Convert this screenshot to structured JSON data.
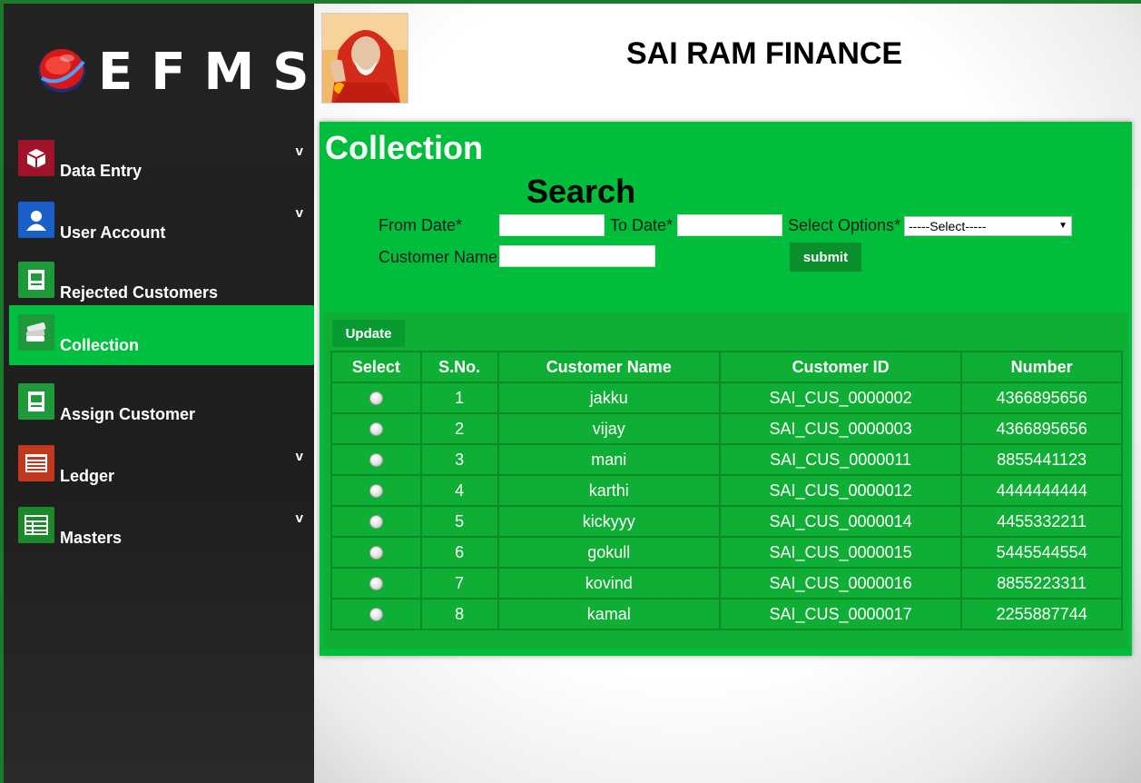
{
  "brand": {
    "logo_text": "EFMS",
    "app_title": "SAI RAM FINANCE"
  },
  "sidebar": {
    "items": [
      {
        "label": "Data Entry",
        "icon": "box-icon",
        "icon_color": "#a0142a",
        "chevron": "v",
        "active": false
      },
      {
        "label": "User Account",
        "icon": "user-icon",
        "icon_color": "#1a5fc8",
        "chevron": "v",
        "active": false
      },
      {
        "label": "Rejected Customers",
        "icon": "document-icon",
        "icon_color": "#1e9a3a",
        "chevron": "",
        "active": false
      },
      {
        "label": "Collection",
        "icon": "money-icon",
        "icon_color": "#1e9a3a",
        "chevron": "",
        "active": true
      },
      {
        "label": "Assign Customer",
        "icon": "document-icon",
        "icon_color": "#1e9a3a",
        "chevron": "",
        "active": false
      },
      {
        "label": "Ledger",
        "icon": "ledger-icon",
        "icon_color": "#c0391e",
        "chevron": "v",
        "active": false
      },
      {
        "label": "Masters",
        "icon": "table-icon",
        "icon_color": "#1a8a2a",
        "chevron": "v",
        "active": false
      }
    ]
  },
  "main": {
    "section_title": "Collection",
    "search": {
      "title": "Search",
      "from_date_label": "From Date*",
      "from_date_value": "",
      "to_date_label": "To Date*",
      "to_date_value": "",
      "select_options_label": "Select Options*",
      "select_options_value": "-----Select-----",
      "customer_name_label": "Customer Name",
      "customer_name_value": "",
      "submit_label": "submit"
    },
    "update_label": "Update",
    "table": {
      "headers": [
        "Select",
        "S.No.",
        "Customer Name",
        "Customer ID",
        "Number"
      ],
      "rows": [
        {
          "sno": "1",
          "name": "jakku",
          "id": "SAI_CUS_0000002",
          "number": "4366895656"
        },
        {
          "sno": "2",
          "name": "vijay",
          "id": "SAI_CUS_0000003",
          "number": "4366895656"
        },
        {
          "sno": "3",
          "name": "mani",
          "id": "SAI_CUS_0000011",
          "number": "8855441123"
        },
        {
          "sno": "4",
          "name": "karthi",
          "id": "SAI_CUS_0000012",
          "number": "4444444444"
        },
        {
          "sno": "5",
          "name": "kickyyy",
          "id": "SAI_CUS_0000014",
          "number": "4455332211"
        },
        {
          "sno": "6",
          "name": "gokull",
          "id": "SAI_CUS_0000015",
          "number": "5445544554"
        },
        {
          "sno": "7",
          "name": "kovind",
          "id": "SAI_CUS_0000016",
          "number": "8855223311"
        },
        {
          "sno": "8",
          "name": "kamal",
          "id": "SAI_CUS_0000017",
          "number": "2255887744"
        }
      ]
    }
  },
  "colors": {
    "panel_green": "#00bd3b",
    "active_nav": "#00c040",
    "table_green": "#0fae35",
    "button_green": "#0a8f2c"
  }
}
